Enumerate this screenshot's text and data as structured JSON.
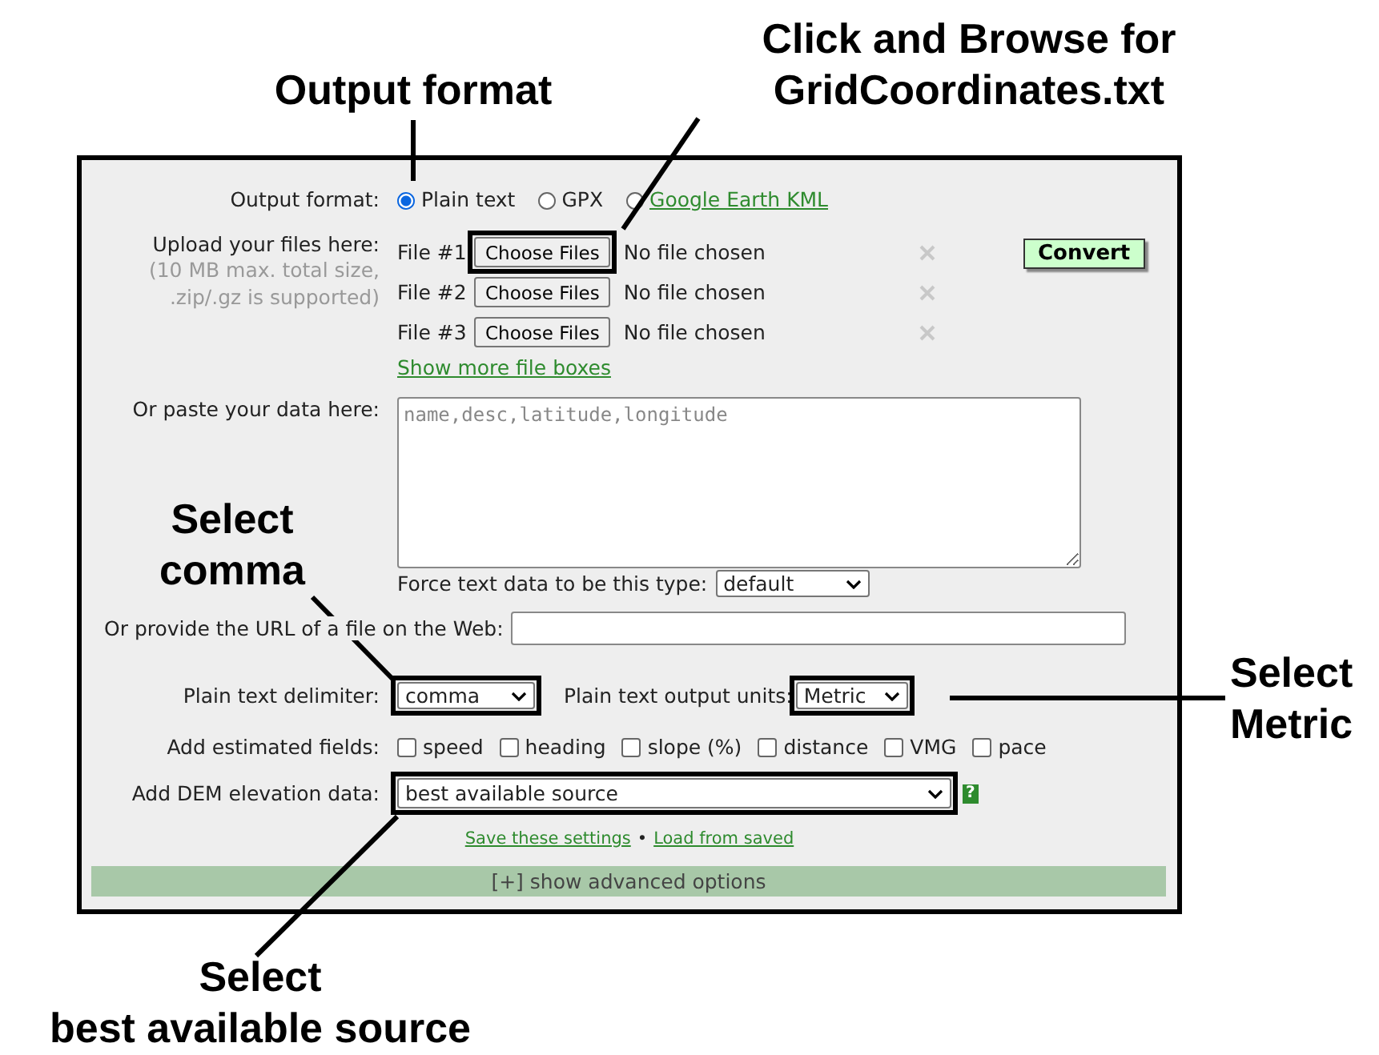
{
  "callouts": [
    {
      "kind": "top",
      "lines": [
        "Output format"
      ]
    },
    {
      "kind": "top-right",
      "lines": [
        "Click and Browse for",
        "GridCoordinates.txt"
      ]
    },
    {
      "kind": "left",
      "lines": [
        "Select",
        "comma"
      ]
    },
    {
      "kind": "right",
      "lines": [
        "Select",
        "Metric"
      ]
    },
    {
      "kind": "bottom",
      "lines": [
        "Select",
        "best available source"
      ]
    }
  ],
  "form": {
    "output_format": {
      "label": "Output format:",
      "options": [
        {
          "label": "Plain text",
          "selected": true,
          "kind": "plain"
        },
        {
          "label": "GPX",
          "selected": false,
          "kind": "plain"
        },
        {
          "label": "Google Earth KML",
          "selected": false,
          "kind": "link"
        }
      ]
    },
    "upload": {
      "label": "Upload your files here:",
      "note": "(10 MB max. total size,\n.zip/.gz is supported)",
      "files": [
        {
          "label": "File #1",
          "button": "Choose Files",
          "status": "No file chosen",
          "highlighted": true
        },
        {
          "label": "File #2",
          "button": "Choose Files",
          "status": "No file chosen",
          "highlighted": false
        },
        {
          "label": "File #3",
          "button": "Choose Files",
          "status": "No file chosen",
          "highlighted": false
        }
      ],
      "more_link": "Show more file boxes",
      "convert_button": "Convert"
    },
    "paste": {
      "label": "Or paste your data here:",
      "placeholder": "name,desc,latitude,longitude"
    },
    "force_type": {
      "label": "Force text data to be this type:",
      "value": "default"
    },
    "url": {
      "label": "Or provide the URL of a file on the Web:"
    },
    "delimiter": {
      "label": "Plain text delimiter:",
      "value": "comma",
      "highlighted": true
    },
    "units": {
      "label": "Plain text output units:",
      "value": "Metric",
      "highlighted": true
    },
    "estimated": {
      "label": "Add estimated fields:",
      "options": [
        {
          "label": "speed",
          "checked": false
        },
        {
          "label": "heading",
          "checked": false
        },
        {
          "label": "slope (%)",
          "checked": false
        },
        {
          "label": "distance",
          "checked": false
        },
        {
          "label": "VMG",
          "checked": false
        },
        {
          "label": "pace",
          "checked": false
        }
      ]
    },
    "dem": {
      "label": "Add DEM elevation data:",
      "value": "best available source",
      "highlighted": true,
      "help": "?"
    },
    "settings_links": {
      "save": "Save these settings",
      "separator": "•",
      "load": "Load from saved"
    },
    "advanced": "[+] show advanced options"
  }
}
